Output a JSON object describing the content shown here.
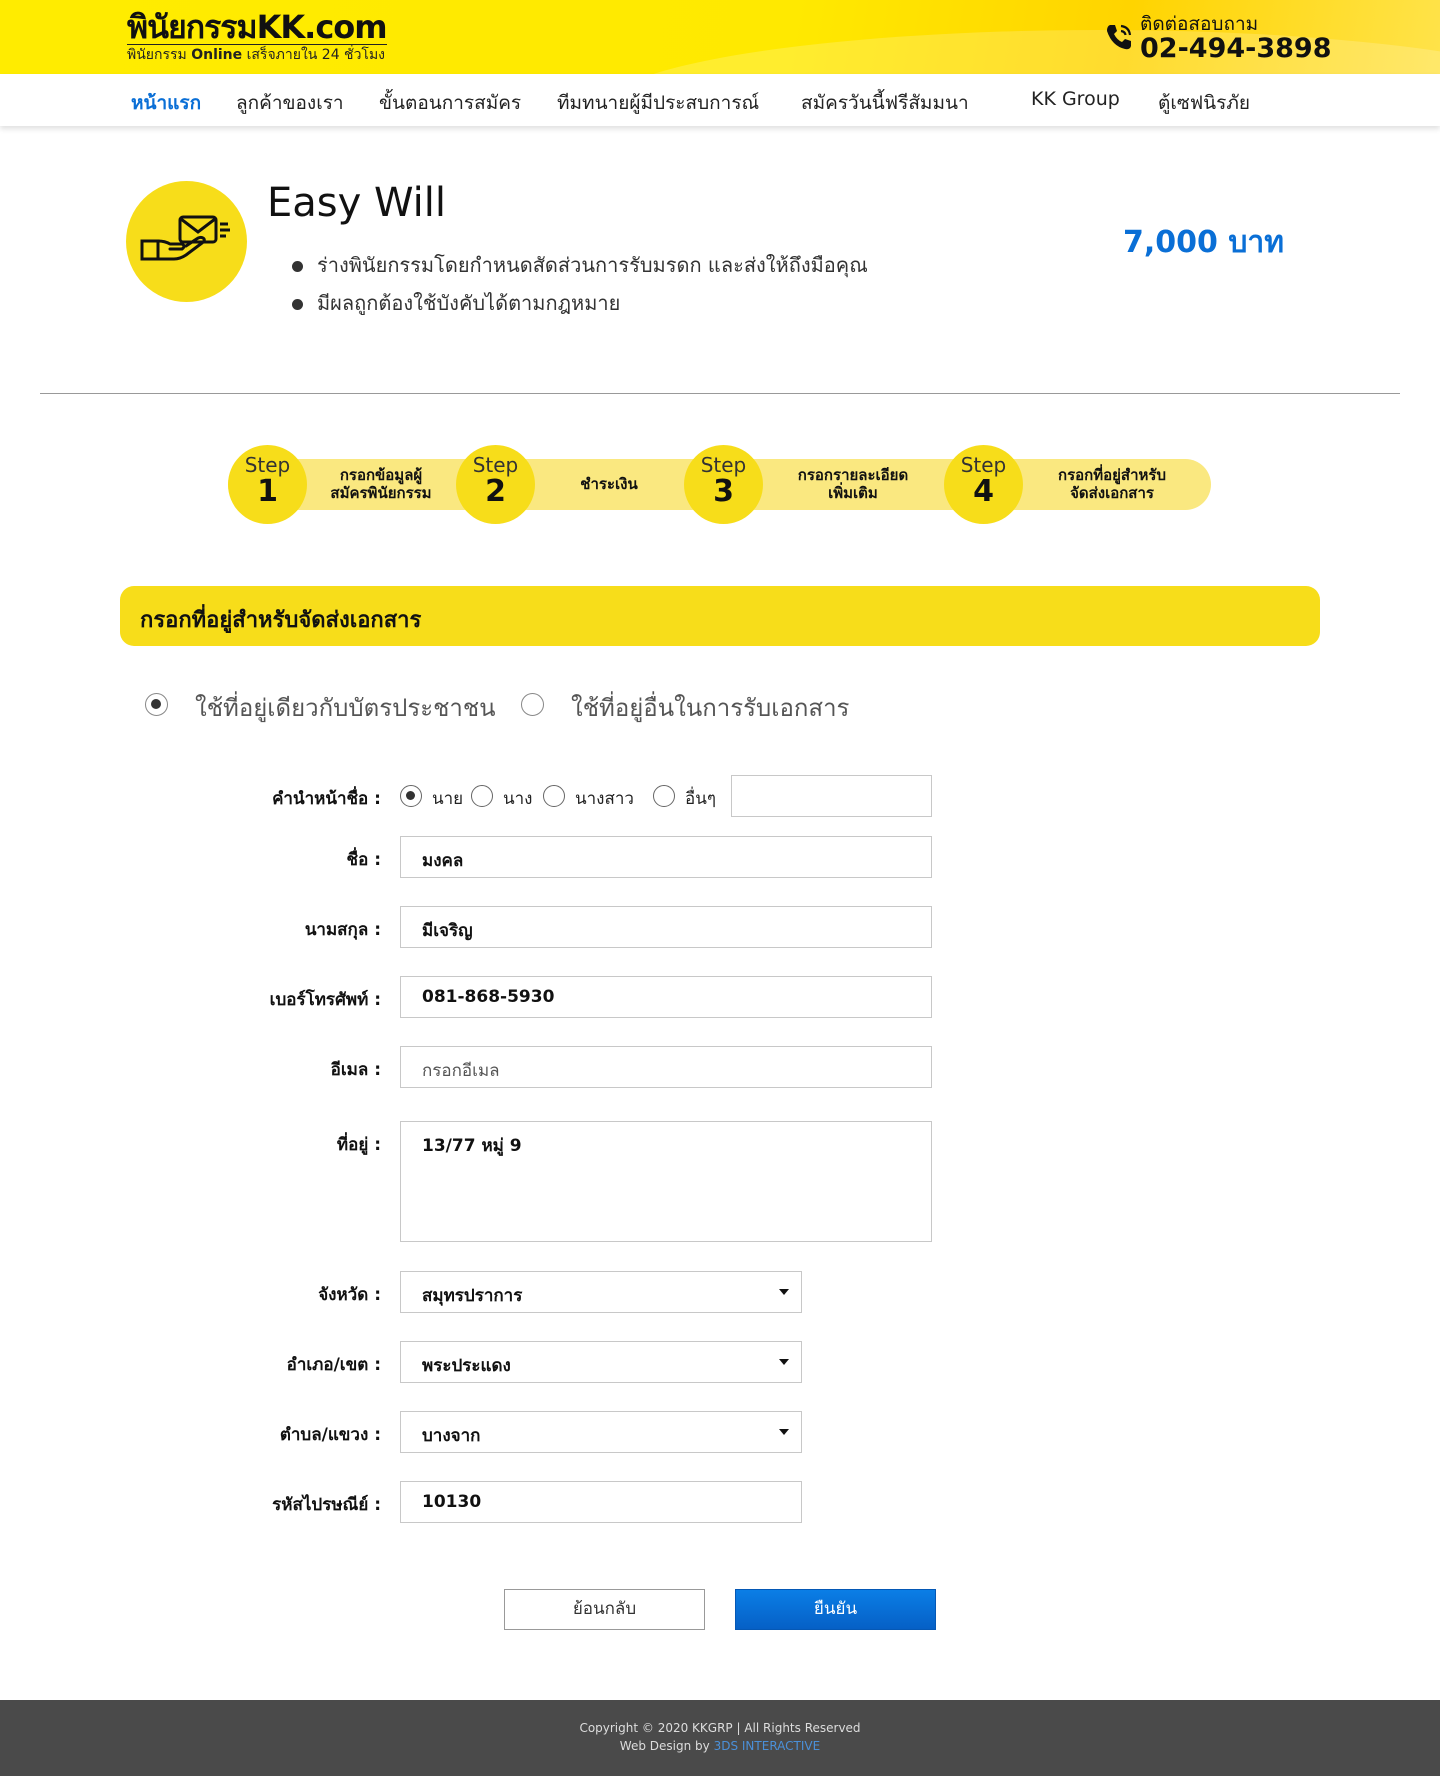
{
  "header": {
    "logo_main": "พินัยกรรมKK.com",
    "logo_sub_pre": "พินัยกรรม",
    "logo_sub_bold": "Online",
    "logo_sub_post": "เสร็จภายใน 24 ชั่วโมง",
    "contact_label": "ติดต่อสอบถาม",
    "contact_number": "02-494-3898",
    "colors": {
      "brand_yellow": "#ffec00",
      "accent_blue": "#0a6fd6"
    }
  },
  "nav": {
    "items": [
      {
        "label": "หน้าแรก",
        "active": true
      },
      {
        "label": "ลูกค้าของเรา"
      },
      {
        "label": "ขั้นตอนการสมัคร"
      },
      {
        "label": "ทีมทนายผู้มีประสบการณ์"
      },
      {
        "label": "สมัครวันนี้ฟรีสัมมนา"
      },
      {
        "label": "KK Group"
      },
      {
        "label": "ตู้เซฟนิรภัย"
      }
    ]
  },
  "product": {
    "title": "Easy Will",
    "bullets": [
      "ร่างพินัยกรรมโดยกำหนดสัดส่วนการรับมรดก และส่งให้ถึงมือคุณ",
      "มีผลถูกต้องใช้บังคับได้ตามกฎหมาย"
    ],
    "price": "7,000 บาท",
    "icon": "envelope-hand-icon"
  },
  "steps": [
    {
      "word": "Step",
      "num": "1",
      "label_line1": "กรอกข้อมูลผู้",
      "label_line2": "สมัครพินัยกรรม"
    },
    {
      "word": "Step",
      "num": "2",
      "label_line1": "ชำระเงิน",
      "label_line2": ""
    },
    {
      "word": "Step",
      "num": "3",
      "label_line1": "กรอกรายละเอียด",
      "label_line2": "เพิ่มเติม"
    },
    {
      "word": "Step",
      "num": "4",
      "label_line1": "กรอกที่อยู่สำหรับ",
      "label_line2": "จัดส่งเอกสาร"
    }
  ],
  "section_title": "กรอกที่อยู่สำหรับจัดส่งเอกสาร",
  "address_option": {
    "same": "ใช้ที่อยู่เดียวกับบัตรประชาชน",
    "other": "ใช้ที่อยู่อื่นในการรับเอกสาร",
    "selected": "same"
  },
  "form": {
    "prefix": {
      "label": "คำนำหน้าชื่อ :",
      "options": [
        "นาย",
        "นาง",
        "นางสาว",
        "อื่นๆ"
      ],
      "selected": "นาย",
      "other_value": ""
    },
    "first_name": {
      "label": "ชื่อ :",
      "value": "มงคล"
    },
    "last_name": {
      "label": "นามสกุล :",
      "value": "มีเจริญ"
    },
    "phone": {
      "label": "เบอร์โทรศัพท์ :",
      "value": "081-868-5930"
    },
    "email": {
      "label": "อีเมล :",
      "value": "",
      "placeholder": "กรอกอีเมล"
    },
    "address": {
      "label": "ที่อยู่ :",
      "value": "13/77 หมู่ 9"
    },
    "province": {
      "label": "จังหวัด :",
      "value": "สมุทรปราการ"
    },
    "district": {
      "label": "อำเภอ/เขต :",
      "value": "พระประแดง"
    },
    "subdistrict": {
      "label": "ตำบล/แขวง :",
      "value": "บางจาก"
    },
    "postcode": {
      "label": "รหัสไปรษณีย์ :",
      "value": "10130"
    }
  },
  "buttons": {
    "back": "ย้อนกลับ",
    "confirm": "ยืนยัน"
  },
  "footer": {
    "copyright": "Copyright © 2020 KKGRP | All Rights Reserved",
    "design_pre": "Web Design by",
    "design_link": "3DS INTERACTIVE"
  }
}
